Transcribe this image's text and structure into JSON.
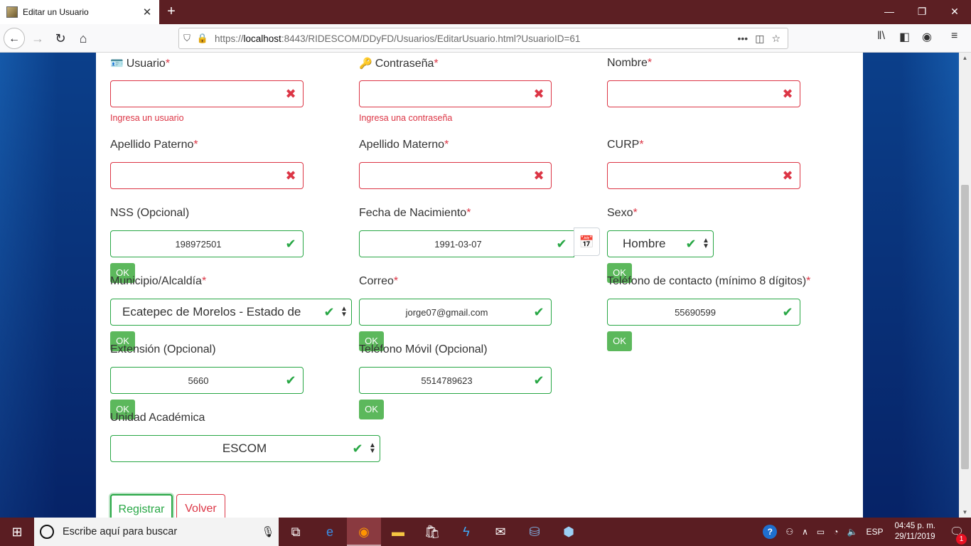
{
  "browser": {
    "tab_title": "Editar un Usuario",
    "tab_close": "✕",
    "new_tab": "+",
    "url_prefix": "https://",
    "url_host": "localhost",
    "url_rest": ":8443/RIDESCOM/DDyFD/Usuarios/EditarUsuario.html?UsuarioID=61",
    "url_more": "•••",
    "win_minimize": "—",
    "win_restore": "❐",
    "win_close": "✕"
  },
  "form": {
    "usuario": {
      "label": "Usuario",
      "req": "*",
      "value": "",
      "error": "Ingresa un usuario"
    },
    "contrasena": {
      "label": "Contraseña",
      "req": "*",
      "value": "",
      "error": "Ingresa una contraseña"
    },
    "nombre": {
      "label": "Nombre",
      "req": "*",
      "value": ""
    },
    "apellido_paterno": {
      "label": "Apellido Paterno",
      "req": "*",
      "value": ""
    },
    "apellido_materno": {
      "label": "Apellido Materno",
      "req": "*",
      "value": ""
    },
    "curp": {
      "label": "CURP",
      "req": "*",
      "value": ""
    },
    "nss": {
      "label": "NSS (Opcional)",
      "value": "198972501",
      "ok": "OK"
    },
    "fecha_nacimiento": {
      "label": "Fecha de Nacimiento",
      "req": "*",
      "value": "1991-03-07"
    },
    "sexo": {
      "label": "Sexo",
      "req": "*",
      "value": "Hombre",
      "ok": "OK"
    },
    "municipio": {
      "label": "Municipio/Alcaldía",
      "req": "*",
      "value": "Ecatepec de Morelos - Estado de",
      "ok": "OK"
    },
    "correo": {
      "label": "Correo",
      "req": "*",
      "value": "jorge07@gmail.com",
      "ok": "OK"
    },
    "telefono_contacto": {
      "label": "Teléfono de contacto (mínimo 8 dígitos)",
      "req": "*",
      "value": "55690599",
      "ok": "OK"
    },
    "extension": {
      "label": "Extensión (Opcional)",
      "value": "5660",
      "ok": "OK"
    },
    "telefono_movil": {
      "label": "Teléfono Móvil (Opcional)",
      "value": "5514789623",
      "ok": "OK"
    },
    "unidad_academica": {
      "label": "Unidad Académica",
      "value": "ESCOM"
    },
    "buttons": {
      "registrar": "Registrar",
      "volver": "Volver"
    }
  },
  "icons": {
    "invalid": "✖",
    "valid": "✔",
    "calendar": "📅",
    "caret": "▲▼"
  },
  "colors": {
    "invalid": "#dc3545",
    "valid": "#28a745",
    "ok_button": "#5cb85c",
    "titlebar": "#5c1f23"
  },
  "taskbar": {
    "search_placeholder": "Escribe aquí para buscar",
    "language": "ESP",
    "time": "04:45 p. m.",
    "date": "29/11/2019",
    "notification_count": "1"
  }
}
